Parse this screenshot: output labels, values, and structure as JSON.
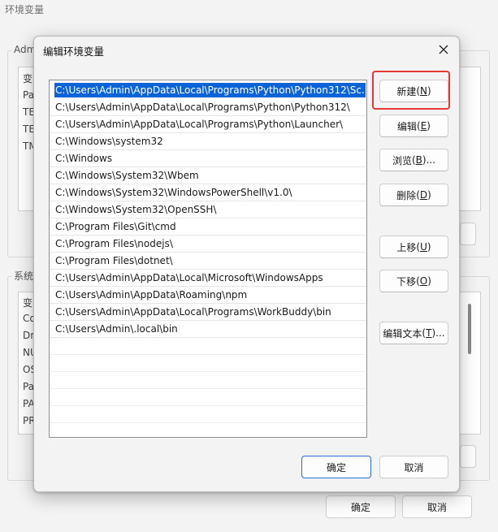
{
  "background": {
    "title": "环境变量",
    "user_group_label": "Adm",
    "user_rows": [
      "变",
      "Pa",
      "TE",
      "TE",
      "TM"
    ],
    "system_group_label": "系统",
    "system_rows": [
      "变",
      "Co",
      "Dr",
      "NU",
      "OS",
      "Pa",
      "PA",
      "PR"
    ],
    "ok_label": "确定",
    "cancel_label": "取消"
  },
  "dialog": {
    "title": "编辑环境变量",
    "paths": [
      "C:\\Users\\Admin\\AppData\\Local\\Programs\\Python\\Python312\\Sc...",
      "C:\\Users\\Admin\\AppData\\Local\\Programs\\Python\\Python312\\",
      "C:\\Users\\Admin\\AppData\\Local\\Programs\\Python\\Launcher\\",
      "C:\\Windows\\system32",
      "C:\\Windows",
      "C:\\Windows\\System32\\Wbem",
      "C:\\Windows\\System32\\WindowsPowerShell\\v1.0\\",
      "C:\\Windows\\System32\\OpenSSH\\",
      "C:\\Program Files\\Git\\cmd",
      "C:\\Program Files\\nodejs\\",
      "C:\\Program Files\\dotnet\\",
      "C:\\Users\\Admin\\AppData\\Local\\Microsoft\\WindowsApps",
      "C:\\Users\\Admin\\AppData\\Roaming\\npm",
      "C:\\Users\\Admin\\AppData\\Local\\Programs\\WorkBuddy\\bin",
      "C:\\Users\\Admin\\.local\\bin"
    ],
    "selected_index": 0,
    "buttons": {
      "new_label": "新建",
      "new_key": "N",
      "edit_label": "编辑",
      "edit_key": "E",
      "browse_label": "浏览",
      "browse_key": "B",
      "browse_suffix": "...",
      "delete_label": "删除",
      "delete_key": "D",
      "up_label": "上移",
      "up_key": "U",
      "down_label": "下移",
      "down_key": "O",
      "edit_text_label": "编辑文本",
      "edit_text_key": "T",
      "edit_text_suffix": "...",
      "ok_label": "确定",
      "cancel_label": "取消"
    },
    "highlight_color": "#e53935",
    "selection_color": "#0a64d8"
  }
}
